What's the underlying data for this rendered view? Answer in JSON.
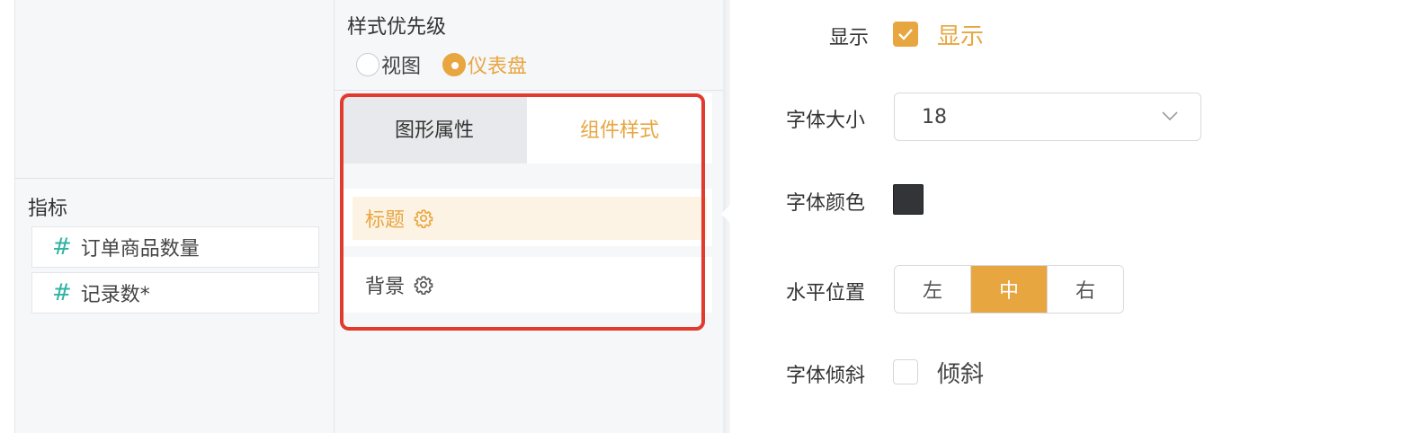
{
  "left": {
    "section_title": "指标",
    "fields": [
      {
        "icon": "hash-icon",
        "label": "订单商品数量"
      },
      {
        "icon": "hash-icon",
        "label": "记录数*"
      }
    ]
  },
  "middle": {
    "priority_title": "样式优先级",
    "radios": [
      {
        "label": "视图",
        "checked": false
      },
      {
        "label": "仪表盘",
        "checked": true
      }
    ],
    "tabs": [
      {
        "label": "图形属性",
        "active": false
      },
      {
        "label": "组件样式",
        "active": true
      }
    ],
    "items": [
      {
        "label": "标题",
        "icon": "gear-icon",
        "selected": true
      },
      {
        "label": "背景",
        "icon": "gear-icon",
        "selected": false
      }
    ]
  },
  "settings": {
    "show_label": "显示",
    "show_checkbox_text": "显示",
    "show_checked": true,
    "font_size_label": "字体大小",
    "font_size_value": "18",
    "font_color_label": "字体颜色",
    "font_color_value": "#333438",
    "align_label": "水平位置",
    "align_options": [
      "左",
      "中",
      "右"
    ],
    "align_selected": "中",
    "italic_label": "字体倾斜",
    "italic_checkbox_text": "倾斜",
    "italic_checked": false
  },
  "colors": {
    "accent": "#e8a640",
    "highlight_border": "#e23b2e",
    "field_icon": "#2fb3a3"
  }
}
